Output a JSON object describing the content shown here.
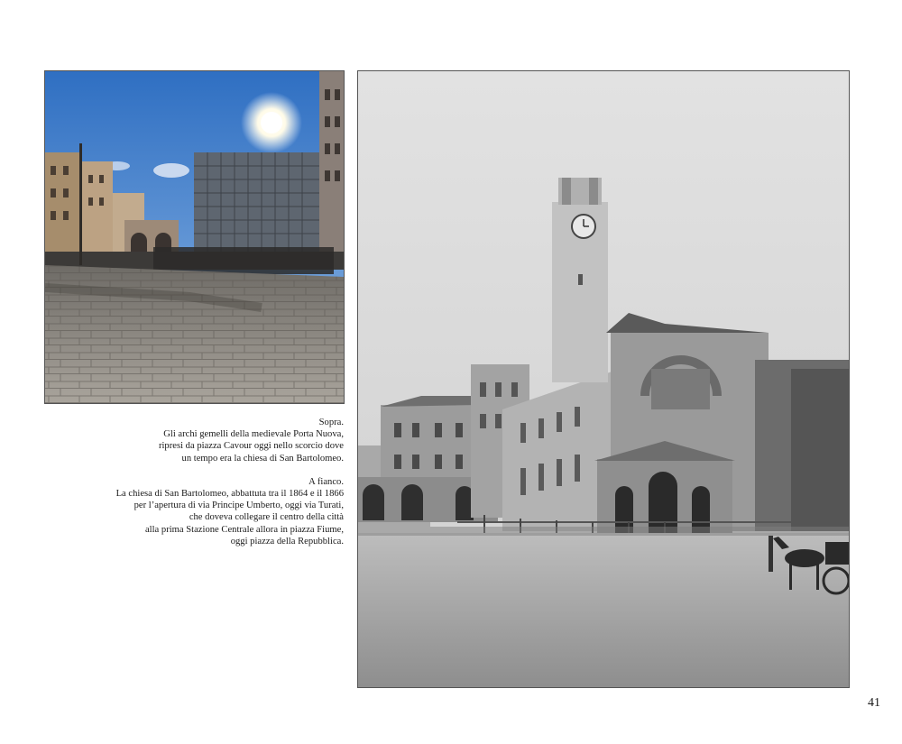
{
  "photos": {
    "top": {
      "subject": "piazza-cavour-porta-nuova-arches"
    },
    "right": {
      "subject": "san-bartolomeo-church-ruins"
    }
  },
  "captions": {
    "above": {
      "lines": [
        "Sopra.",
        "Gli archi gemelli della medievale Porta Nuova,",
        "ripresi da piazza Cavour oggi nello scorcio dove",
        "un tempo era la chiesa di San Bartolomeo."
      ]
    },
    "beside": {
      "lines": [
        "A fianco.",
        "La chiesa di San Bartolomeo, abbattuta tra il 1864 e il 1866",
        "per l’apertura di via Principe Umberto, oggi via Turati,",
        "che doveva collegare il centro della città",
        "alla prima Stazione Centrale allora in piazza Fiume,",
        "oggi piazza della Repubblica."
      ]
    }
  },
  "page": {
    "number": "41"
  }
}
